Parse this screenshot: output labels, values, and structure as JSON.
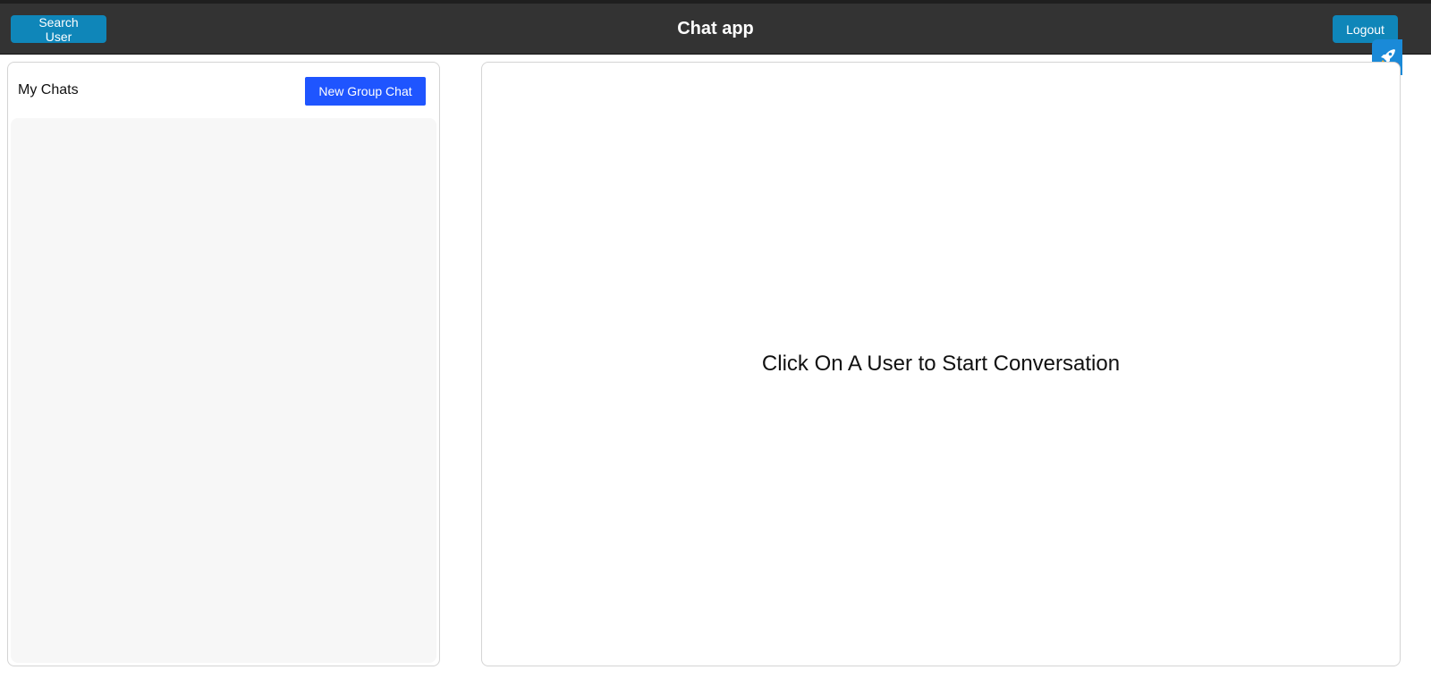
{
  "header": {
    "title": "Chat app",
    "search_label": "Search User",
    "logout_label": "Logout"
  },
  "sidebar": {
    "heading": "My Chats",
    "new_group_label": "New Group Chat",
    "chats": []
  },
  "main": {
    "placeholder": "Click On A User to Start Conversation"
  },
  "icons": {
    "extension": "rocket-icon"
  },
  "colors": {
    "header_bg": "#333333",
    "header_button": "#0f86b9",
    "new_group_button": "#1f55ff",
    "chat_list_bg": "#f7f7f7"
  }
}
